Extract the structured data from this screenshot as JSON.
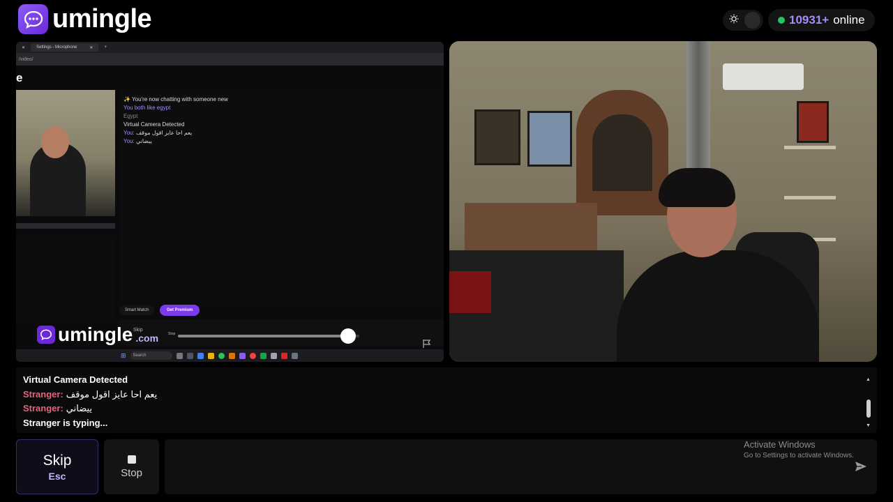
{
  "header": {
    "brand": "umingle",
    "online_count": "10931+",
    "online_label": "online"
  },
  "inner_screen": {
    "tab_title": "Settings - Microphone",
    "url": "/video/",
    "site_letter": "e",
    "chat": {
      "intro": "✨ You're now chatting with someone new",
      "interest_prefix": "You both like",
      "interest_value": "egypt",
      "country": "Egypt",
      "notice": "Virtual Camera Detected",
      "you_label": "You:",
      "msg1": "يعم احا عايز اقول موقف",
      "msg2": "ييضاني"
    },
    "smart_match": "Smart Match",
    "get_premium": "Get Premium",
    "skip_small": "Skip",
    "stop_small": "Stop",
    "search": "Search",
    "watermark_brand": "umingle",
    "watermark_domain": ".com",
    "seek_fraction": 0.94
  },
  "chat_log": {
    "notice": "Virtual Camera Detected",
    "messages": [
      {
        "sender": "Stranger:",
        "text": "يعم احا عايز اقول موقف"
      },
      {
        "sender": "Stranger:",
        "text": "ييضاني"
      }
    ],
    "typing": "Stranger is typing..."
  },
  "controls": {
    "skip_label": "Skip",
    "skip_key": "Esc",
    "stop_label": "Stop",
    "message_value": "",
    "message_placeholder": ""
  },
  "os_overlay": {
    "title": "Activate Windows",
    "subtitle": "Go to Settings to activate Windows."
  },
  "colors": {
    "accent": "#7c3aed",
    "online": "#22c55e",
    "stranger": "#e6627d"
  },
  "icons": {
    "logo": "chat-bubble-icon",
    "theme": "sun-icon",
    "send": "send-icon"
  }
}
